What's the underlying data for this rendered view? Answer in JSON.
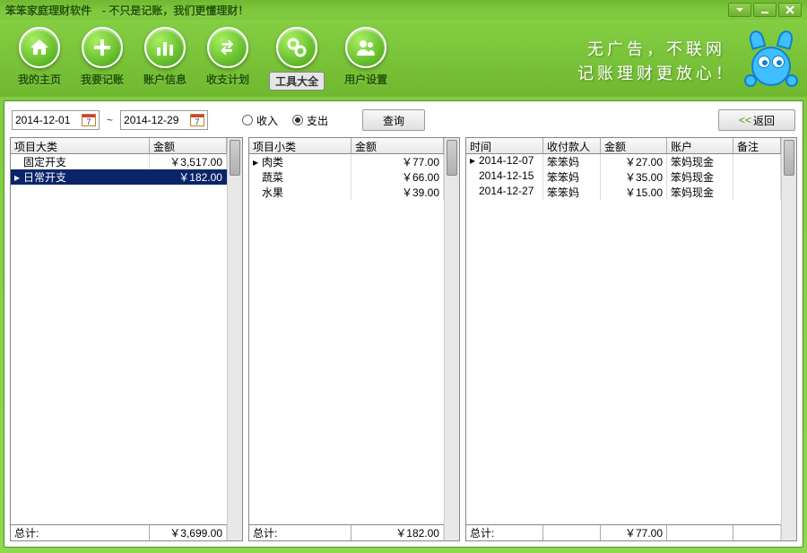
{
  "app_title": "笨笨家庭理财软件　- 不只是记账，我们更懂理财！",
  "toolbar": [
    {
      "id": "home",
      "label": "我的主页"
    },
    {
      "id": "record",
      "label": "我要记账"
    },
    {
      "id": "account",
      "label": "账户信息"
    },
    {
      "id": "plan",
      "label": "收支计划"
    },
    {
      "id": "tools",
      "label": "工具大全"
    },
    {
      "id": "users",
      "label": "用户设置"
    }
  ],
  "active_toolbar": "tools",
  "slogan_line1": "无广告，不联网",
  "slogan_line2": "记账理财更放心！",
  "filter": {
    "date_from": "2014-12-01",
    "date_to": "2014-12-29",
    "radio_income": "收入",
    "radio_expense": "支出",
    "selected_radio": "expense",
    "query_btn": "查询",
    "back_btn": "返回"
  },
  "pane1": {
    "headers": [
      "项目大类",
      "金额"
    ],
    "rows": [
      {
        "name": "固定开支",
        "amount": "￥3,517.00",
        "selected": false
      },
      {
        "name": "日常开支",
        "amount": "￥182.00",
        "selected": true
      }
    ],
    "footer_label": "总计:",
    "footer_amount": "￥3,699.00"
  },
  "pane2": {
    "headers": [
      "项目小类",
      "金额"
    ],
    "rows": [
      {
        "name": "肉类",
        "amount": "￥77.00"
      },
      {
        "name": "蔬菜",
        "amount": "￥66.00"
      },
      {
        "name": "水果",
        "amount": "￥39.00"
      }
    ],
    "footer_label": "总计:",
    "footer_amount": "￥182.00"
  },
  "pane3": {
    "headers": [
      "时间",
      "收付款人",
      "金额",
      "账户",
      "备注"
    ],
    "rows": [
      {
        "date": "2014-12-07",
        "payee": "笨笨妈",
        "amount": "￥27.00",
        "account": "笨妈现金",
        "note": ""
      },
      {
        "date": "2014-12-15",
        "payee": "笨笨妈",
        "amount": "￥35.00",
        "account": "笨妈现金",
        "note": ""
      },
      {
        "date": "2014-12-27",
        "payee": "笨笨妈",
        "amount": "￥15.00",
        "account": "笨妈现金",
        "note": ""
      }
    ],
    "footer_label": "总计:",
    "footer_amount": "￥77.00"
  }
}
